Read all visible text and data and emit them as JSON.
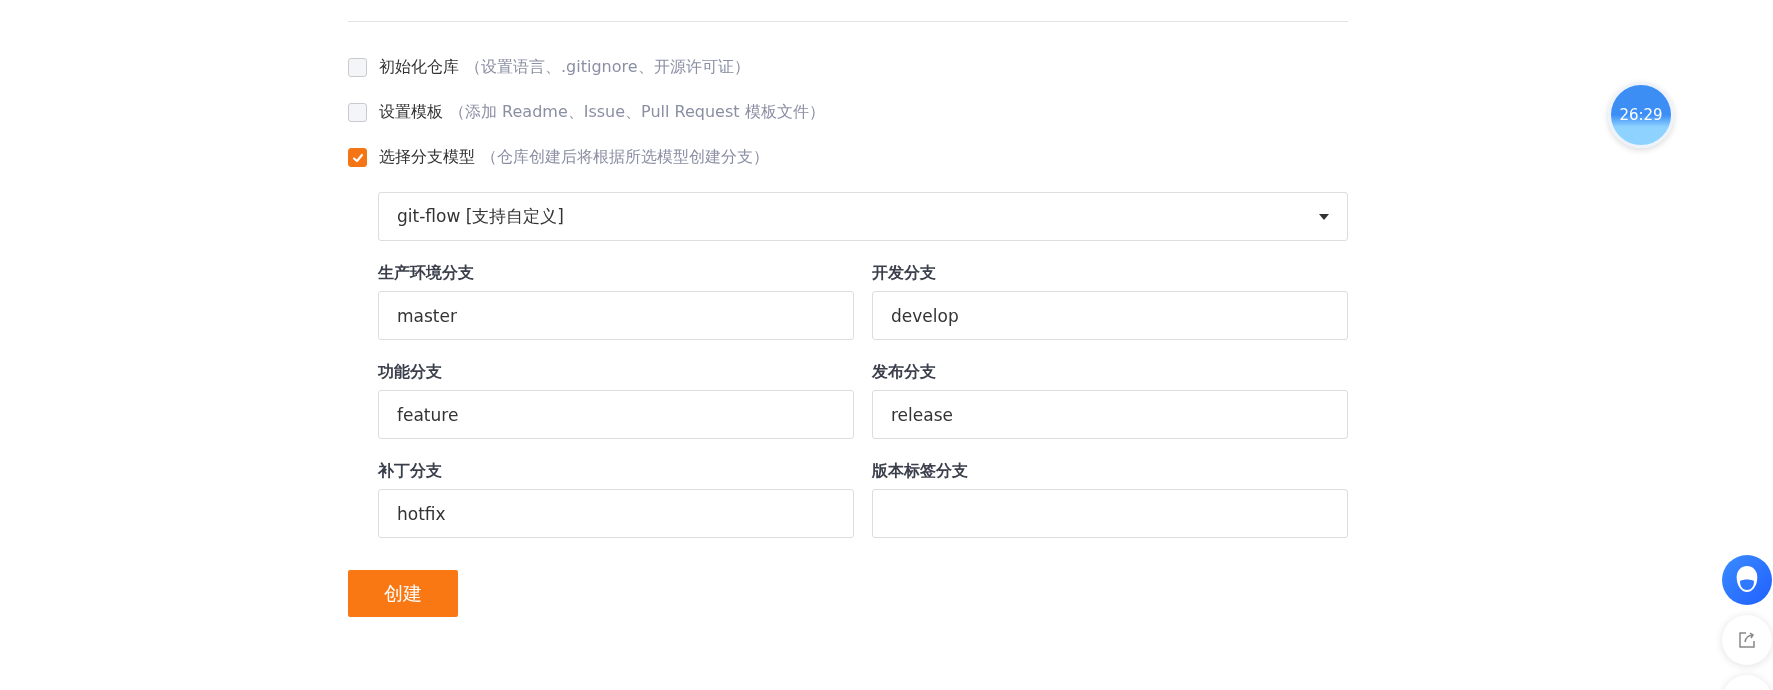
{
  "options": [
    {
      "label": "初始化仓库",
      "hint": "（设置语言、.gitignore、开源许可证）",
      "checked": false
    },
    {
      "label": "设置模板",
      "hint": "（添加 Readme、Issue、Pull Request 模板文件）",
      "checked": false
    },
    {
      "label": "选择分支模型",
      "hint": "（仓库创建后将根据所选模型创建分支）",
      "checked": true
    }
  ],
  "branch_model": {
    "value": "git-flow [支持自定义]"
  },
  "branches": [
    {
      "label": "生产环境分支",
      "value": "master"
    },
    {
      "label": "开发分支",
      "value": "develop"
    },
    {
      "label": "功能分支",
      "value": "feature"
    },
    {
      "label": "发布分支",
      "value": "release"
    },
    {
      "label": "补丁分支",
      "value": "hotfix"
    },
    {
      "label": "版本标签分支"
    }
  ],
  "create_button": "创建",
  "timer": "26:29"
}
